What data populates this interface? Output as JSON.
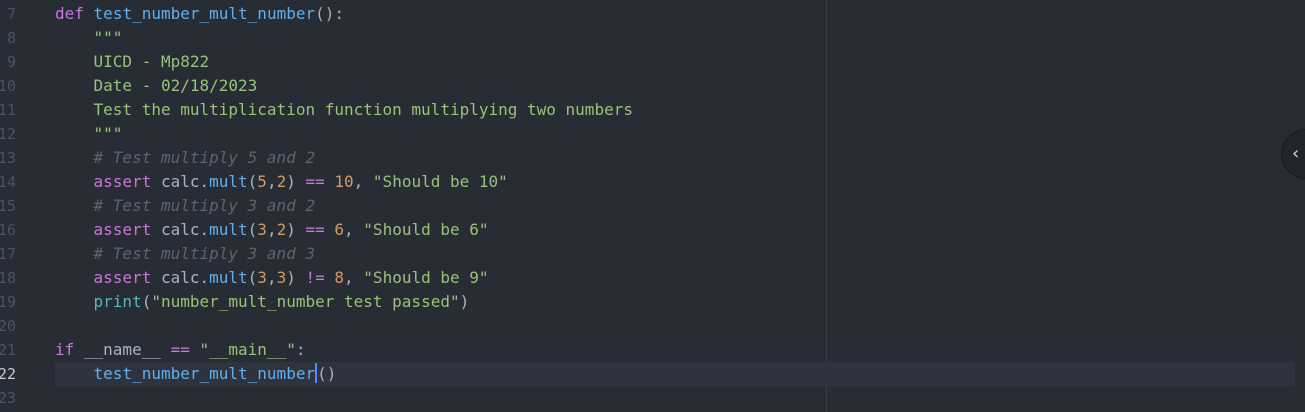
{
  "gutter": {
    "line_numbers": [
      "7",
      "8",
      "9",
      "10",
      "11",
      "12",
      "13",
      "14",
      "15",
      "16",
      "17",
      "18",
      "19",
      "20",
      "21",
      "22",
      "23"
    ],
    "active_line": "22"
  },
  "code": {
    "l7": {
      "kw": "def",
      "sp": " ",
      "fn": "test_number_mult_number",
      "rest": "():"
    },
    "l8": {
      "indent": "    ",
      "str": "\"\"\""
    },
    "l9": {
      "indent": "    ",
      "str": "UICD - Mp822"
    },
    "l10": {
      "indent": "    ",
      "str": "Date - 02/18/2023"
    },
    "l11": {
      "indent": "    ",
      "str": "Test the multiplication function multiplying two numbers"
    },
    "l12": {
      "indent": "    ",
      "str": "\"\"\""
    },
    "l13": {
      "indent": "    ",
      "cmt": "# Test multiply 5 and 2"
    },
    "l14": {
      "indent": "    ",
      "kw": "assert",
      "obj": " calc.",
      "fn": "mult",
      "p1": "(",
      "a": "5",
      "c": ",",
      "b": "2",
      "p2": ") ",
      "op": "==",
      "sp": " ",
      "num": "10",
      "comma": ", ",
      "str": "\"Should be 10\""
    },
    "l15": {
      "indent": "    ",
      "cmt": "# Test multiply 3 and 2"
    },
    "l16": {
      "indent": "    ",
      "kw": "assert",
      "obj": " calc.",
      "fn": "mult",
      "p1": "(",
      "a": "3",
      "c": ",",
      "b": "2",
      "p2": ") ",
      "op": "==",
      "sp": " ",
      "num": "6",
      "comma": ", ",
      "str": "\"Should be 6\""
    },
    "l17": {
      "indent": "    ",
      "cmt": "# Test multiply 3 and 3"
    },
    "l18": {
      "indent": "    ",
      "kw": "assert",
      "obj": " calc.",
      "fn": "mult",
      "p1": "(",
      "a": "3",
      "c": ",",
      "b": "3",
      "p2": ") ",
      "op": "!=",
      "sp": " ",
      "num": "8",
      "comma": ", ",
      "str": "\"Should be 9\""
    },
    "l19": {
      "indent": "    ",
      "builtin": "print",
      "p1": "(",
      "str": "\"number_mult_number test passed\"",
      "p2": ")"
    },
    "l20": {
      "text": ""
    },
    "l21": {
      "kw": "if",
      "mid": " __name__ ",
      "op": "==",
      "sp": " ",
      "str": "\"__main__\"",
      "rest": ":"
    },
    "l22": {
      "indent": "    ",
      "fn": "test_number_mult_number",
      "rest": "()"
    },
    "l23": {
      "text": ""
    }
  },
  "side_toggle": {
    "icon": "chevron-left-icon",
    "glyph": "‹"
  },
  "colors": {
    "background": "#282c34",
    "keyword": "#c678dd",
    "function": "#61afef",
    "string": "#98c379",
    "number": "#d19a66",
    "comment": "#5c6370",
    "builtin": "#56b6c2",
    "cursor": "#528bff"
  }
}
